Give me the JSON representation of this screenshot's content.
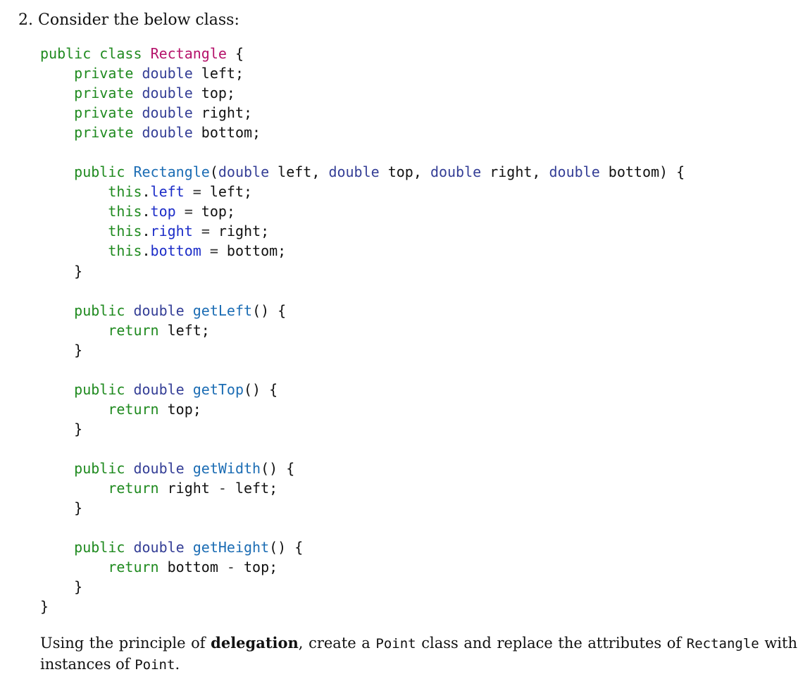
{
  "question": {
    "number": "2.",
    "prompt": "Consider the below class:"
  },
  "code": {
    "lines": [
      [
        {
          "t": "public",
          "c": "kw"
        },
        {
          "t": " ",
          "c": "plain"
        },
        {
          "t": "class",
          "c": "kw"
        },
        {
          "t": " ",
          "c": "plain"
        },
        {
          "t": "Rectangle",
          "c": "class"
        },
        {
          "t": " {",
          "c": "plain"
        }
      ],
      [
        {
          "t": "    ",
          "c": "plain"
        },
        {
          "t": "private",
          "c": "kw"
        },
        {
          "t": " ",
          "c": "plain"
        },
        {
          "t": "double",
          "c": "type"
        },
        {
          "t": " left;",
          "c": "plain"
        }
      ],
      [
        {
          "t": "    ",
          "c": "plain"
        },
        {
          "t": "private",
          "c": "kw"
        },
        {
          "t": " ",
          "c": "plain"
        },
        {
          "t": "double",
          "c": "type"
        },
        {
          "t": " top;",
          "c": "plain"
        }
      ],
      [
        {
          "t": "    ",
          "c": "plain"
        },
        {
          "t": "private",
          "c": "kw"
        },
        {
          "t": " ",
          "c": "plain"
        },
        {
          "t": "double",
          "c": "type"
        },
        {
          "t": " right;",
          "c": "plain"
        }
      ],
      [
        {
          "t": "    ",
          "c": "plain"
        },
        {
          "t": "private",
          "c": "kw"
        },
        {
          "t": " ",
          "c": "plain"
        },
        {
          "t": "double",
          "c": "type"
        },
        {
          "t": " bottom;",
          "c": "plain"
        }
      ],
      [],
      [
        {
          "t": "    ",
          "c": "plain"
        },
        {
          "t": "public",
          "c": "kw"
        },
        {
          "t": " ",
          "c": "plain"
        },
        {
          "t": "Rectangle",
          "c": "method"
        },
        {
          "t": "(",
          "c": "plain"
        },
        {
          "t": "double",
          "c": "type"
        },
        {
          "t": " left, ",
          "c": "plain"
        },
        {
          "t": "double",
          "c": "type"
        },
        {
          "t": " top, ",
          "c": "plain"
        },
        {
          "t": "double",
          "c": "type"
        },
        {
          "t": " right, ",
          "c": "plain"
        },
        {
          "t": "double",
          "c": "type"
        },
        {
          "t": " bottom) {",
          "c": "plain"
        }
      ],
      [
        {
          "t": "        ",
          "c": "plain"
        },
        {
          "t": "this",
          "c": "kw"
        },
        {
          "t": ".",
          "c": "plain"
        },
        {
          "t": "left",
          "c": "field"
        },
        {
          "t": " ",
          "c": "plain"
        },
        {
          "t": "=",
          "c": "op"
        },
        {
          "t": " left;",
          "c": "plain"
        }
      ],
      [
        {
          "t": "        ",
          "c": "plain"
        },
        {
          "t": "this",
          "c": "kw"
        },
        {
          "t": ".",
          "c": "plain"
        },
        {
          "t": "top",
          "c": "field"
        },
        {
          "t": " ",
          "c": "plain"
        },
        {
          "t": "=",
          "c": "op"
        },
        {
          "t": " top;",
          "c": "plain"
        }
      ],
      [
        {
          "t": "        ",
          "c": "plain"
        },
        {
          "t": "this",
          "c": "kw"
        },
        {
          "t": ".",
          "c": "plain"
        },
        {
          "t": "right",
          "c": "field"
        },
        {
          "t": " ",
          "c": "plain"
        },
        {
          "t": "=",
          "c": "op"
        },
        {
          "t": " right;",
          "c": "plain"
        }
      ],
      [
        {
          "t": "        ",
          "c": "plain"
        },
        {
          "t": "this",
          "c": "kw"
        },
        {
          "t": ".",
          "c": "plain"
        },
        {
          "t": "bottom",
          "c": "field"
        },
        {
          "t": " ",
          "c": "plain"
        },
        {
          "t": "=",
          "c": "op"
        },
        {
          "t": " bottom;",
          "c": "plain"
        }
      ],
      [
        {
          "t": "    }",
          "c": "plain"
        }
      ],
      [],
      [
        {
          "t": "    ",
          "c": "plain"
        },
        {
          "t": "public",
          "c": "kw"
        },
        {
          "t": " ",
          "c": "plain"
        },
        {
          "t": "double",
          "c": "type"
        },
        {
          "t": " ",
          "c": "plain"
        },
        {
          "t": "getLeft",
          "c": "method"
        },
        {
          "t": "() {",
          "c": "plain"
        }
      ],
      [
        {
          "t": "        ",
          "c": "plain"
        },
        {
          "t": "return",
          "c": "kw"
        },
        {
          "t": " left;",
          "c": "plain"
        }
      ],
      [
        {
          "t": "    }",
          "c": "plain"
        }
      ],
      [],
      [
        {
          "t": "    ",
          "c": "plain"
        },
        {
          "t": "public",
          "c": "kw"
        },
        {
          "t": " ",
          "c": "plain"
        },
        {
          "t": "double",
          "c": "type"
        },
        {
          "t": " ",
          "c": "plain"
        },
        {
          "t": "getTop",
          "c": "method"
        },
        {
          "t": "() {",
          "c": "plain"
        }
      ],
      [
        {
          "t": "        ",
          "c": "plain"
        },
        {
          "t": "return",
          "c": "kw"
        },
        {
          "t": " top;",
          "c": "plain"
        }
      ],
      [
        {
          "t": "    }",
          "c": "plain"
        }
      ],
      [],
      [
        {
          "t": "    ",
          "c": "plain"
        },
        {
          "t": "public",
          "c": "kw"
        },
        {
          "t": " ",
          "c": "plain"
        },
        {
          "t": "double",
          "c": "type"
        },
        {
          "t": " ",
          "c": "plain"
        },
        {
          "t": "getWidth",
          "c": "method"
        },
        {
          "t": "() {",
          "c": "plain"
        }
      ],
      [
        {
          "t": "        ",
          "c": "plain"
        },
        {
          "t": "return",
          "c": "kw"
        },
        {
          "t": " right ",
          "c": "plain"
        },
        {
          "t": "-",
          "c": "op"
        },
        {
          "t": " left;",
          "c": "plain"
        }
      ],
      [
        {
          "t": "    }",
          "c": "plain"
        }
      ],
      [],
      [
        {
          "t": "    ",
          "c": "plain"
        },
        {
          "t": "public",
          "c": "kw"
        },
        {
          "t": " ",
          "c": "plain"
        },
        {
          "t": "double",
          "c": "type"
        },
        {
          "t": " ",
          "c": "plain"
        },
        {
          "t": "getHeight",
          "c": "method"
        },
        {
          "t": "() {",
          "c": "plain"
        }
      ],
      [
        {
          "t": "        ",
          "c": "plain"
        },
        {
          "t": "return",
          "c": "kw"
        },
        {
          "t": " bottom ",
          "c": "plain"
        },
        {
          "t": "-",
          "c": "op"
        },
        {
          "t": " top;",
          "c": "plain"
        }
      ],
      [
        {
          "t": "    }",
          "c": "plain"
        }
      ],
      [
        {
          "t": "}",
          "c": "plain"
        }
      ]
    ]
  },
  "instruction": {
    "part1": "Using the principle of ",
    "emphasis": "delegation",
    "part2": ", create a ",
    "code1": "Point",
    "part3": " class and replace the attributes of ",
    "code2": "Rectangle",
    "part4": " with instances of ",
    "code3": "Point",
    "part5": "."
  },
  "colors": {
    "keyword": "#1f8a1f",
    "type": "#343e96",
    "class_name": "#b5136b",
    "method_name": "#1c6db4",
    "field_name": "#1c2dc8"
  }
}
